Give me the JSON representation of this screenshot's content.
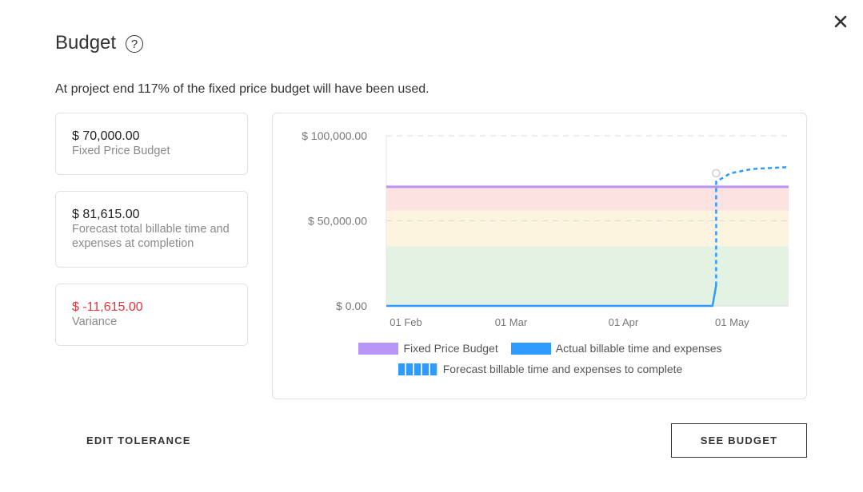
{
  "modal": {
    "title": "Budget",
    "help_glyph": "?",
    "close_glyph": "✕",
    "summary": "At project end 117% of the fixed price budget will have been used."
  },
  "cards": [
    {
      "value": "$ 70,000.00",
      "label": "Fixed Price Budget",
      "status": "normal"
    },
    {
      "value": "$ 81,615.00",
      "label": "Forecast total billable time and expenses at completion",
      "status": "normal"
    },
    {
      "value": "$ -11,615.00",
      "label": "Variance",
      "status": "negative"
    }
  ],
  "colors": {
    "budget_line": "#b995f5",
    "actual_line": "#2f9bff",
    "forecast_line": "#2f9bff",
    "band_red": "#fde2e2",
    "band_yellow": "#fdf4df",
    "band_green": "#e4f2e4",
    "variance_negative": "#e8333a"
  },
  "chart_data": {
    "type": "line",
    "title": "",
    "xlabel": "",
    "ylabel": "",
    "y_ticks": [
      "$ 100,000.00",
      "$ 50,000.00",
      "$ 0.00"
    ],
    "y_tick_values": [
      100000,
      50000,
      0
    ],
    "x_ticks": [
      "01 Feb",
      "01 Mar",
      "01 Apr",
      "01 May"
    ],
    "x_tick_dates": [
      "2020-02-01",
      "2020-03-01",
      "2020-04-01",
      "2020-05-01"
    ],
    "x_range": [
      "2020-01-31",
      "2020-05-21"
    ],
    "ylim": [
      0,
      100000
    ],
    "grid": "horizontal-dashed",
    "legend_position": "bottom",
    "tolerance_bands": [
      {
        "from": 0,
        "to": 35000,
        "color": "band_green"
      },
      {
        "from": 35000,
        "to": 56000,
        "color": "band_yellow"
      },
      {
        "from": 56000,
        "to": 70000,
        "color": "band_red"
      }
    ],
    "series": [
      {
        "name": "Fixed Price Budget",
        "style": "solid",
        "color": "budget_line",
        "points": [
          [
            "2020-01-31",
            70000
          ],
          [
            "2020-05-21",
            70000
          ]
        ]
      },
      {
        "name": "Actual billable time and expenses",
        "style": "solid",
        "color": "actual_line",
        "points": [
          [
            "2020-01-31",
            0
          ],
          [
            "2020-04-30",
            0
          ],
          [
            "2020-05-01",
            12000
          ]
        ]
      },
      {
        "name": "Forecast billable time and expenses to complete",
        "style": "dashed",
        "color": "forecast_line",
        "points": [
          [
            "2020-05-01",
            12000
          ],
          [
            "2020-05-01",
            73000
          ],
          [
            "2020-05-05",
            78000
          ],
          [
            "2020-05-11",
            80500
          ],
          [
            "2020-05-21",
            81615
          ]
        ]
      }
    ],
    "markers": [
      {
        "series": "Forecast billable time and expenses to complete",
        "date": "2020-05-01",
        "value": 78000,
        "shape": "hollow-circle"
      }
    ]
  },
  "buttons": {
    "edit_tolerance": "EDIT TOLERANCE",
    "see_budget": "SEE BUDGET"
  }
}
